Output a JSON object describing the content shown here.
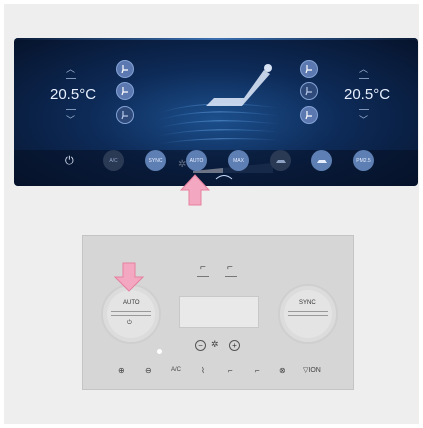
{
  "screen": {
    "left_temp": "20.5°C",
    "right_temp": "20.5°C",
    "fan_levels": 8,
    "fan_level_value": 3,
    "buttons": [
      {
        "name": "power-button",
        "label": ""
      },
      {
        "name": "ac-button",
        "label": "A/C"
      },
      {
        "name": "sync-button",
        "label": "SYNC"
      },
      {
        "name": "auto-button",
        "label": "AUTO"
      },
      {
        "name": "max-defrost-button",
        "label": "MAX"
      },
      {
        "name": "recirculation-button",
        "label": ""
      },
      {
        "name": "fresh-air-button",
        "label": ""
      },
      {
        "name": "pm25-button",
        "label": "PM2.5"
      }
    ]
  },
  "panel": {
    "left_knob_label": "AUTO",
    "right_knob_label": "SYNC",
    "bottom_labels": {
      "ac": "A/C",
      "ion": "ION"
    }
  },
  "colors": {
    "screen_bg": "#0d2a57",
    "button_blue": "#5e7fb3",
    "highlight_pink": "#f4a7c0"
  }
}
